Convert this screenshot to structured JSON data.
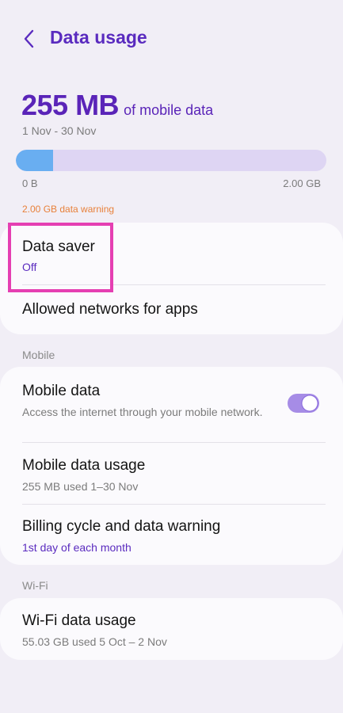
{
  "header": {
    "title": "Data usage",
    "back_icon": "chevron-left-icon"
  },
  "summary": {
    "amount": "255 MB",
    "suffix": "of mobile data",
    "date_range": "1 Nov - 30 Nov",
    "usage_fraction": 0.12,
    "axis_min": "0 B",
    "axis_max": "2.00 GB",
    "warning": "2.00 GB data warning"
  },
  "data_saver_card": {
    "data_saver": {
      "title": "Data saver",
      "status": "Off"
    },
    "allowed_networks": {
      "title": "Allowed networks for apps"
    }
  },
  "mobile_section": {
    "label": "Mobile",
    "mobile_data": {
      "title": "Mobile data",
      "description": "Access the internet through your mobile network.",
      "enabled": true
    },
    "mobile_data_usage": {
      "title": "Mobile data usage",
      "subtitle": "255 MB used 1–30 Nov"
    },
    "billing_cycle": {
      "title": "Billing cycle and data warning",
      "subtitle": "1st day of each month"
    }
  },
  "wifi_section": {
    "label": "Wi-Fi",
    "wifi_data_usage": {
      "title": "Wi-Fi data usage",
      "subtitle": "55.03 GB used 5 Oct – 2 Nov"
    }
  },
  "colors": {
    "accent": "#5a2bbf",
    "progress_fill": "#69aef1",
    "progress_track": "#ded5f3",
    "warning": "#e8803a",
    "highlight": "#e53fb2"
  }
}
